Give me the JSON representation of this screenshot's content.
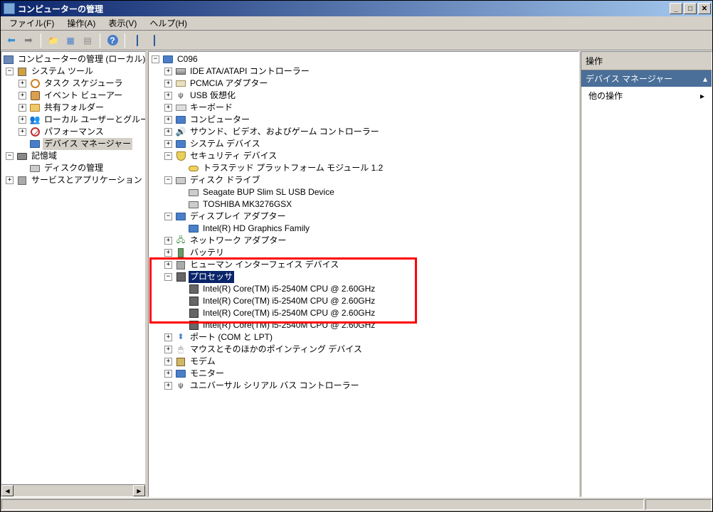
{
  "window": {
    "title": "コンピューターの管理"
  },
  "menu": {
    "file": "ファイル(F)",
    "action": "操作(A)",
    "view": "表示(V)",
    "help": "ヘルプ(H)"
  },
  "left_tree": {
    "root": "コンピューターの管理 (ローカル)",
    "system_tools": "システム ツール",
    "task_scheduler": "タスク スケジューラ",
    "event_viewer": "イベント ビューアー",
    "shared_folders": "共有フォルダー",
    "local_users": "ローカル ユーザーとグルー",
    "performance": "パフォーマンス",
    "device_manager": "デバイス マネージャー",
    "storage": "記憶域",
    "disk_mgmt": "ディスクの管理",
    "services_apps": "サービスとアプリケーション"
  },
  "center_tree": {
    "root": "C096",
    "ide": "IDE ATA/ATAPI コントローラー",
    "pcmcia": "PCMCIA アダプター",
    "usb_virt": "USB 仮想化",
    "keyboard": "キーボード",
    "computer": "コンピューター",
    "sound": "サウンド、ビデオ、およびゲーム コントローラー",
    "system_devices": "システム デバイス",
    "security_devices": "セキュリティ デバイス",
    "tpm": "トラステッド プラットフォーム モジュール 1.2",
    "disk_drives": "ディスク ドライブ",
    "seagate": "Seagate BUP Slim SL USB Device",
    "toshiba": "TOSHIBA MK3276GSX",
    "display": "ディスプレイ アダプター",
    "intel_hd": "Intel(R) HD Graphics Family",
    "network": "ネットワーク アダプター",
    "battery": "バッテリ",
    "hid": "ヒューマン インターフェイス デバイス",
    "processor": "プロセッサ",
    "cpu1": "Intel(R) Core(TM) i5-2540M CPU @ 2.60GHz",
    "cpu2": "Intel(R) Core(TM) i5-2540M CPU @ 2.60GHz",
    "cpu3": "Intel(R) Core(TM) i5-2540M CPU @ 2.60GHz",
    "cpu4": "Intel(R) Core(TM) i5-2540M CPU @ 2.60GHz",
    "ports": "ポート (COM と LPT)",
    "mouse": "マウスとそのほかのポインティング デバイス",
    "modem": "モデム",
    "monitor": "モニター",
    "usb_ctrl": "ユニバーサル シリアル バス コントローラー"
  },
  "actions": {
    "header": "操作",
    "section": "デバイス マネージャー",
    "more": "他の操作"
  }
}
